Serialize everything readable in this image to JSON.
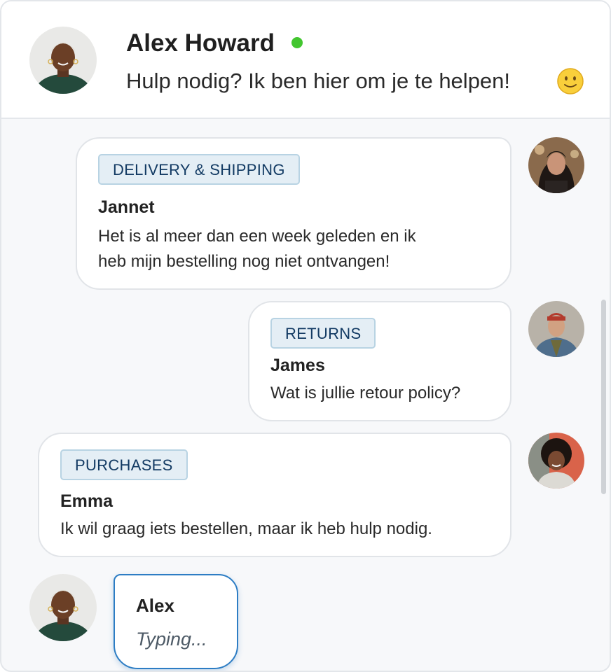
{
  "agent": {
    "name": "Alex Howard",
    "status": "online",
    "tagline": "Hulp nodig? Ik ben hier om je te helpen!",
    "emoji": "slightly-smiling-face-icon"
  },
  "messages": [
    {
      "category": "DELIVERY & SHIPPING",
      "sender": "Jannet",
      "text_line1": "Het is al meer dan een week geleden en ik",
      "text_line2": "heb mijn bestelling nog niet ontvangen!"
    },
    {
      "category": "RETURNS",
      "sender": "James",
      "text_line1": "Wat is jullie retour policy?"
    },
    {
      "category": "PURCHASES",
      "sender": "Emma",
      "text_line1": "Ik wil graag iets bestellen, maar ik heb hulp nodig."
    }
  ],
  "typing": {
    "sender": "Alex",
    "status": "Typing..."
  },
  "colors": {
    "online": "#42c62f",
    "tag_bg": "#e4eef5",
    "tag_text": "#123a63",
    "typing_border": "#2d7dc4"
  }
}
